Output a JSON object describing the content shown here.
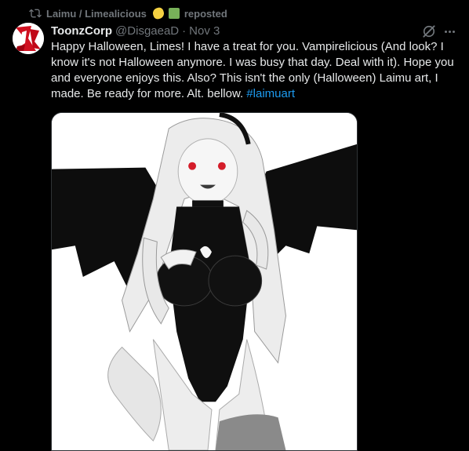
{
  "repost": {
    "icon": "repost-icon",
    "reposter_name": "Laimu / Limealicious",
    "emojis": [
      "lemon-emoji",
      "green-square-emoji"
    ],
    "label": "reposted"
  },
  "post": {
    "author": {
      "display_name": "ToonzCorp",
      "handle": "@DisgaeaD",
      "separator": "·",
      "date": "Nov 3",
      "avatar_icon": "avatar-logo"
    },
    "text_main": "Happy Halloween, Limes! I have a treat for you. Vampirelicious (And look? I know it's not Halloween anymore. I was busy that day. Deal with it). Hope you and everyone enjoys this. Also? This isn't the only (Halloween) Laimu art, I made. Be ready for more. Alt. bellow.",
    "hashtag": "#laimuart",
    "media": {
      "type": "illustration",
      "description_icon": "post-image"
    }
  },
  "actions": {
    "grok_icon": "grok-icon",
    "more_icon": "more-icon"
  },
  "colors": {
    "background": "#000000",
    "text_primary": "#e7e9ea",
    "text_secondary": "#71767b",
    "link": "#1d9bf0",
    "avatar_red": "#d01020"
  }
}
